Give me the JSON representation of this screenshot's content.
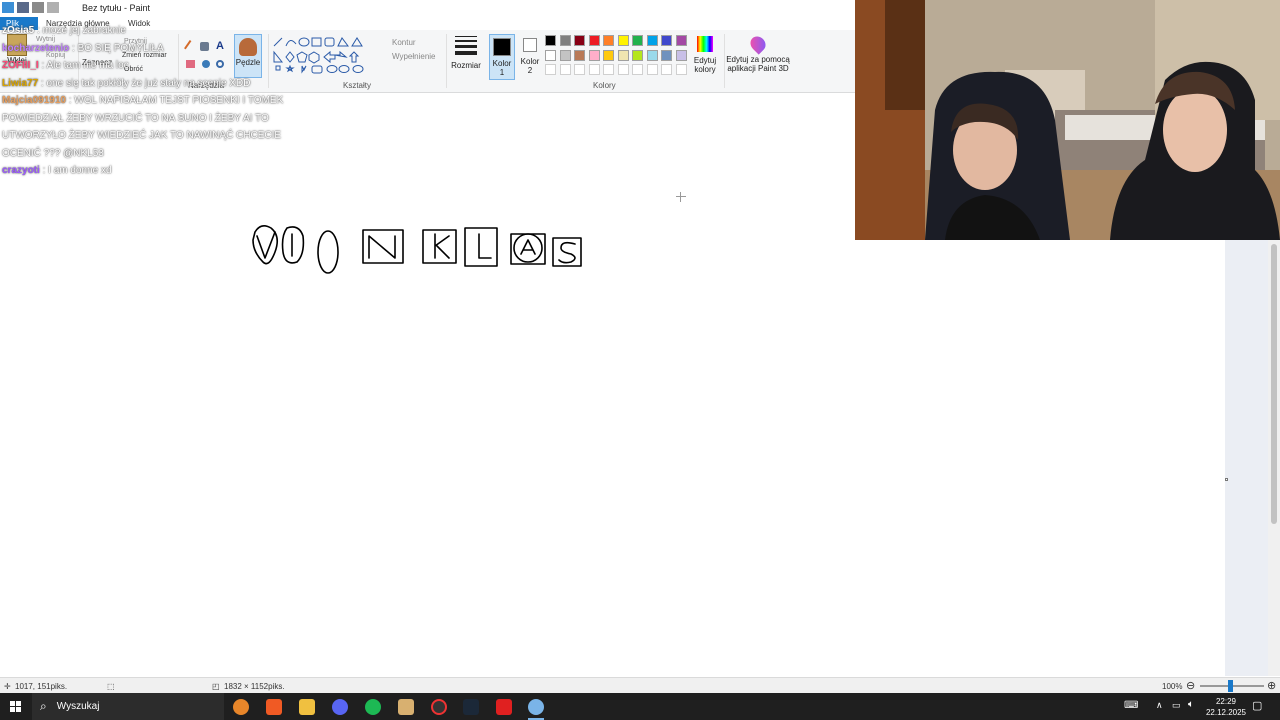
{
  "app": {
    "title": "Bez tytułu - Paint",
    "tabs": [
      "Plik",
      "Narzędzia główne",
      "Widok"
    ]
  },
  "ribbon": {
    "clipboard": {
      "paste": "Wklej",
      "cut": "Wytnij",
      "copy": "Kopiuj"
    },
    "image": {
      "select": "Zaznacz",
      "crop": "Przytnij",
      "resize": "Zmień rozmiar",
      "rotate": "Obróć"
    },
    "tools_label": "Narzędzia",
    "brushes": "Pędzle",
    "shapes": {
      "outline": "Kontur",
      "fill": "Wypełnienie",
      "label": "Kształty"
    },
    "size": "Rozmiar",
    "color1": "Kolor 1",
    "color2": "Kolor 2",
    "colors_label": "Kolory",
    "edit_colors": "Edytuj kolory",
    "paint3d": "Edytuj za pomocą aplikacji Paint 3D",
    "palette_row1": [
      "#000000",
      "#7f7f7f",
      "#880015",
      "#ed1c24",
      "#ff7f27",
      "#fff200",
      "#22b14c",
      "#00a2e8",
      "#3f48cc",
      "#a349a4"
    ],
    "palette_row2": [
      "#ffffff",
      "#c3c3c3",
      "#b97a57",
      "#ffaec9",
      "#ffc90e",
      "#efe4b0",
      "#b5e61d",
      "#99d9ea",
      "#7092be",
      "#c8bfe7"
    ]
  },
  "chat": [
    {
      "user": "zOsia5",
      "color": "#ffffff",
      "text": ": może jej zabraknie"
    },
    {
      "user": "kocharzetenio",
      "color": "#c080ff",
      "text": ": BO SIĘ POMYLIŁA"
    },
    {
      "user": "ZOFIII_I",
      "color": "#ff4a7a",
      "text": ": Ale tam nie ma loc"
    },
    {
      "user": "Liwia77",
      "color": "#d9a400",
      "text": ": one się tak pokłóły że już stały na scenie XDD"
    },
    {
      "user": "Majcia091910",
      "color": "#e8a060",
      "text": ": WGL NAPISAŁAM TEJST PIOSENKI I TOMEK POWIEDZIAŁ ŻEBY WRZUCIĆ TO NA SUNO I ŻEBY AI TO UTWORZYŁO ŻEBY WIEDZIEĆ JAK TO NAWINĄĆ CHCECIE OCENIĆ ??? @NKL53"
    },
    {
      "user": "crazyoti",
      "color": "#9b59ff",
      "text": ": I am donne xd"
    }
  ],
  "canvas": {
    "drawing_letters": [
      "V",
      "I",
      "O",
      "N",
      "K",
      "L",
      "A",
      "S"
    ]
  },
  "status": {
    "cursor_pos": "1017, 151piks.",
    "canvas_size": "1832 × 1152piks.",
    "zoom": "100%"
  },
  "taskbar": {
    "search_placeholder": "Wyszukaj",
    "time": "22:29",
    "date": "22.12.2025"
  }
}
